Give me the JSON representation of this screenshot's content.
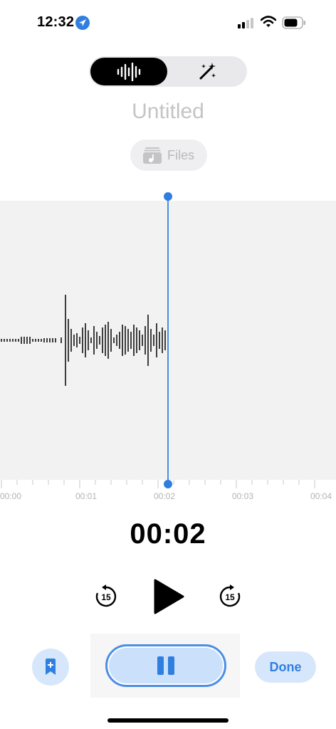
{
  "status": {
    "time": "12:32"
  },
  "icons": {
    "location": "location-arrow-icon",
    "signal": "cellular-signal-icon",
    "wifi": "wifi-icon",
    "battery": "battery-icon",
    "waveform": "waveform-icon",
    "enhance": "magic-wand-icon",
    "files": "music-folder-icon",
    "skip_back": "skip-back-15-icon",
    "play": "play-icon",
    "skip_forward": "skip-forward-15-icon",
    "bookmark": "bookmark-add-icon",
    "pause": "pause-icon"
  },
  "recording": {
    "title": "Untitled",
    "files_label": "Files",
    "elapsed": "00:02"
  },
  "timeline": {
    "labels": [
      "00:00",
      "00:01",
      "00:02",
      "00:03",
      "00:04"
    ]
  },
  "controls": {
    "skip_seconds": "15",
    "done_label": "Done"
  },
  "colors": {
    "accent": "#2f7fe0",
    "accent_light": "#d7e7fb",
    "pause_fill": "#cbe0fb"
  }
}
